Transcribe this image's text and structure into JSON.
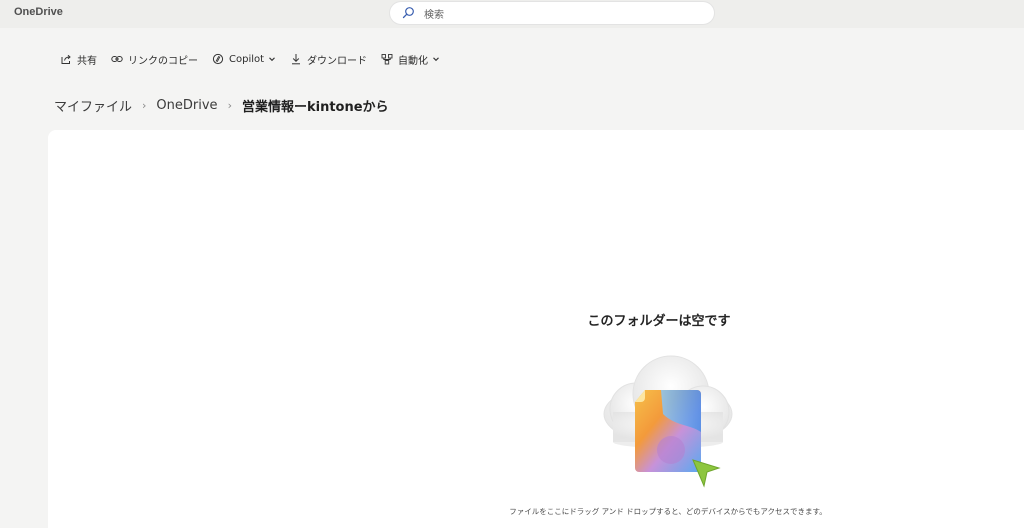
{
  "app": {
    "title": "OneDrive"
  },
  "search": {
    "placeholder": "検索",
    "icon": "search-icon"
  },
  "toolbar": {
    "items": [
      {
        "label": "共有",
        "icon": "share-icon",
        "dropdown": false
      },
      {
        "label": "リンクのコピー",
        "icon": "link-icon",
        "dropdown": false
      },
      {
        "label": "Copilot",
        "icon": "copilot-icon",
        "dropdown": true
      },
      {
        "label": "ダウンロード",
        "icon": "download-icon",
        "dropdown": false
      },
      {
        "label": "自動化",
        "icon": "automate-icon",
        "dropdown": true
      }
    ]
  },
  "breadcrumb": {
    "items": [
      "マイファイル",
      "OneDrive",
      "営業情報ーkintoneから"
    ],
    "separator": "›"
  },
  "empty_state": {
    "title": "このフォルダーは空です",
    "description": "ファイルをここにドラッグ アンド ドロップすると、どのデバイスからでもアクセスできます。",
    "illustration": "cloud-file-illustration"
  },
  "colors": {
    "background": "#f4f4f3",
    "panel": "#ffffff",
    "topbar": "#eeeeec",
    "accent_cursor": "#8dc63f"
  }
}
